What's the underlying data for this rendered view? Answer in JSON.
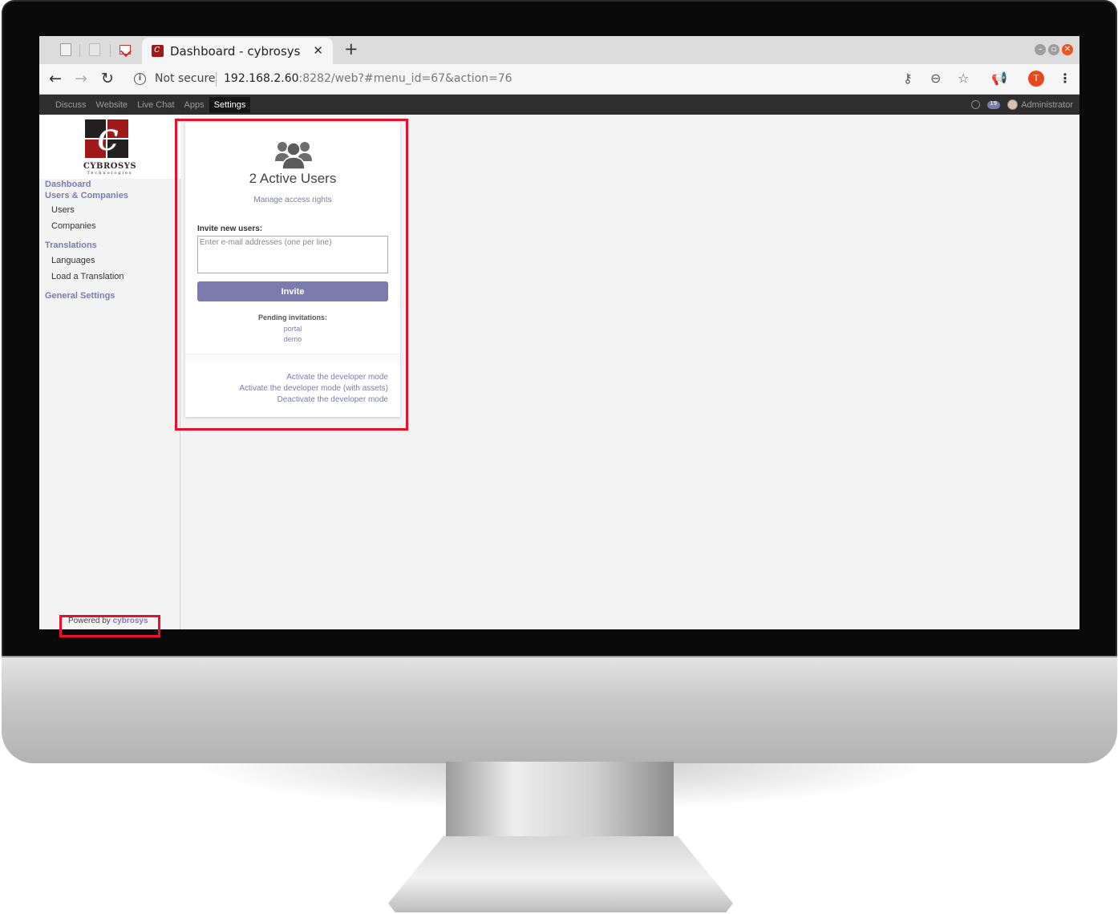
{
  "browser": {
    "tab_title": "Dashboard - cybrosys",
    "tab_close": "✕",
    "new_tab": "+",
    "not_secure": "Not secure",
    "url_host": "192.168.2.60",
    "url_rest": ":8282/web?#menu_id=67&action=76",
    "profile_initial": "T",
    "window_buttons": [
      "–",
      "▫",
      "✕"
    ]
  },
  "odoo_menu": {
    "items": [
      "Discuss",
      "Website",
      "Live Chat",
      "Apps",
      "Settings"
    ],
    "active": "Settings",
    "chat_count": "19",
    "user": "Administrator"
  },
  "sidebar": {
    "logo_text": "CYBROSYS",
    "logo_sub": "Technologies",
    "dashboard": "Dashboard",
    "users_companies": "Users & Companies",
    "users": "Users",
    "companies": "Companies",
    "translations": "Translations",
    "languages": "Languages",
    "load_translation": "Load a Translation",
    "general_settings": "General Settings",
    "powered_prefix": "Powered by",
    "powered_brand": "cybrosys"
  },
  "dashboard": {
    "active_users": "2 Active Users",
    "manage_access": "Manage access rights",
    "invite_label": "Invite new users:",
    "invite_placeholder": "Enter e-mail addresses (one per line)",
    "invite_button": "Invite",
    "pending_label": "Pending invitations:",
    "pending": [
      "portal",
      "demo"
    ],
    "dev_links": [
      "Activate the developer mode",
      "Activate the developer mode (with assets)",
      "Deactivate the developer mode"
    ]
  },
  "colors": {
    "odoo_accent": "#7c7bad",
    "highlight": "#e8112d",
    "logo_red": "#a01818",
    "logo_dark": "#231f20"
  }
}
